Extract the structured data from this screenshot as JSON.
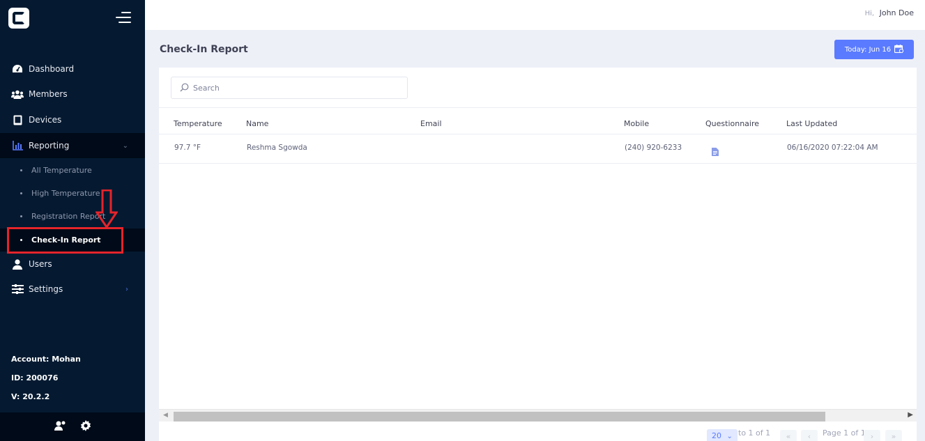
{
  "sidebar": {
    "nav": [
      {
        "label": "Dashboard",
        "icon": "dashboard-icon"
      },
      {
        "label": "Members",
        "icon": "members-icon"
      },
      {
        "label": "Devices",
        "icon": "tablet-icon"
      },
      {
        "label": "Reporting",
        "icon": "chart-icon",
        "expanded": true
      },
      {
        "label": "Users",
        "icon": "user-icon"
      },
      {
        "label": "Settings",
        "icon": "sliders-icon"
      }
    ],
    "reporting_items": [
      {
        "label": "All Temperature"
      },
      {
        "label": "High Temperature"
      },
      {
        "label": "Registration Report"
      },
      {
        "label": "Check-In Report",
        "active": true
      }
    ],
    "account": {
      "account": "Account: Mohan",
      "id": "ID: 200076",
      "version": "V: 20.2.2"
    }
  },
  "topbar": {
    "hi": "Hi,",
    "username": "John Doe"
  },
  "page": {
    "title": "Check-In Report",
    "today_button": "Today: Jun 16"
  },
  "table": {
    "search_placeholder": "Search",
    "columns": [
      "Temperature",
      "Name",
      "Email",
      "Mobile",
      "Questionnaire",
      "Last Updated"
    ],
    "rows": [
      {
        "temperature": "97.7 °F",
        "name": "Reshma Sgowda",
        "email": "",
        "mobile": "(240) 920-6233",
        "questionnaire": "document-icon",
        "last_updated": "06/16/2020 07:22:04 AM"
      }
    ]
  },
  "pagination": {
    "page_size": "20",
    "range": "to 1 of 1",
    "page": "Page 1 of 1",
    "first": "«",
    "prev": "‹",
    "next": "›",
    "last": "»"
  },
  "colors": {
    "sidebar_bg": "#051a31",
    "accent": "#5a7bff",
    "annotation": "#e5242a"
  }
}
